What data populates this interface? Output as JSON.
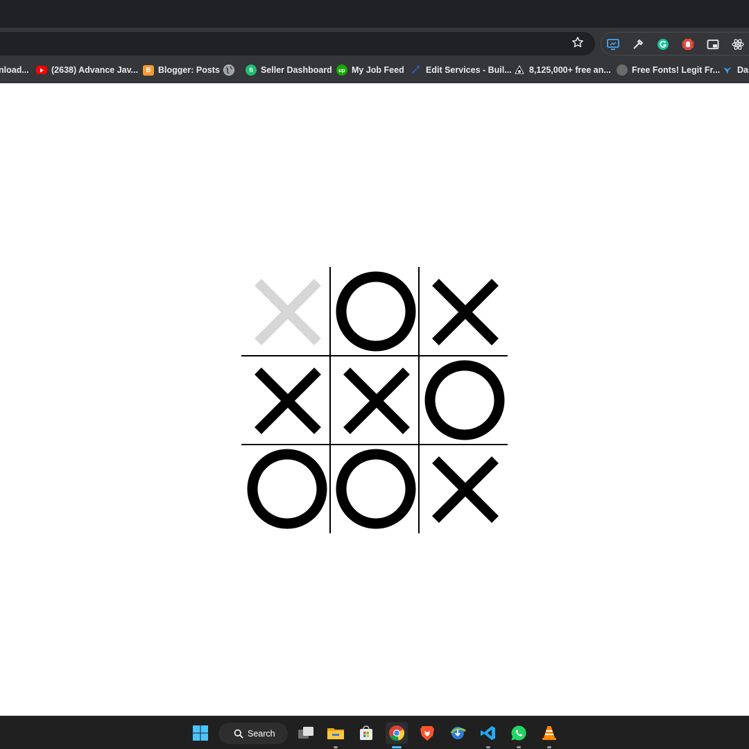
{
  "browser": {
    "bookmarks": [
      {
        "label": "nload...",
        "icon": "download-icon",
        "color": "#35363a"
      },
      {
        "label": "(2638) Advance Jav...",
        "icon": "youtube-icon",
        "color": "#ff0000"
      },
      {
        "label": "Blogger: Posts",
        "icon": "blogger-icon",
        "color": "#f29c38"
      },
      {
        "label": "",
        "icon": "globe-icon",
        "color": "#bdc1c6"
      },
      {
        "label": "Seller Dashboard",
        "icon": "fiverr-icon",
        "color": "#1dbf73"
      },
      {
        "label": "My Job Feed",
        "icon": "upwork-icon",
        "color": "#14a800"
      },
      {
        "label": "Edit Services - Buil...",
        "icon": "service-icon",
        "color": "#2a5db0"
      },
      {
        "label": "8,125,000+ free an...",
        "icon": "freepik-icon",
        "color": "#1f1f1f"
      },
      {
        "label": "Free Fonts! Legit Fr...",
        "icon": "fonts-icon",
        "color": "#6b6b6b"
      },
      {
        "label": "Das",
        "icon": "dashboard-icon",
        "color": "#3ea8f5"
      }
    ]
  },
  "game": {
    "cells": [
      {
        "mark": "X",
        "faded": true
      },
      {
        "mark": "O",
        "faded": false
      },
      {
        "mark": "X",
        "faded": false
      },
      {
        "mark": "X",
        "faded": false
      },
      {
        "mark": "X",
        "faded": false
      },
      {
        "mark": "O",
        "faded": false
      },
      {
        "mark": "O",
        "faded": false
      },
      {
        "mark": "O",
        "faded": false
      },
      {
        "mark": "X",
        "faded": false
      }
    ],
    "colors": {
      "mark": "#000000",
      "faded": "#d6d6d6"
    }
  },
  "taskbar": {
    "search_label": "Search"
  }
}
